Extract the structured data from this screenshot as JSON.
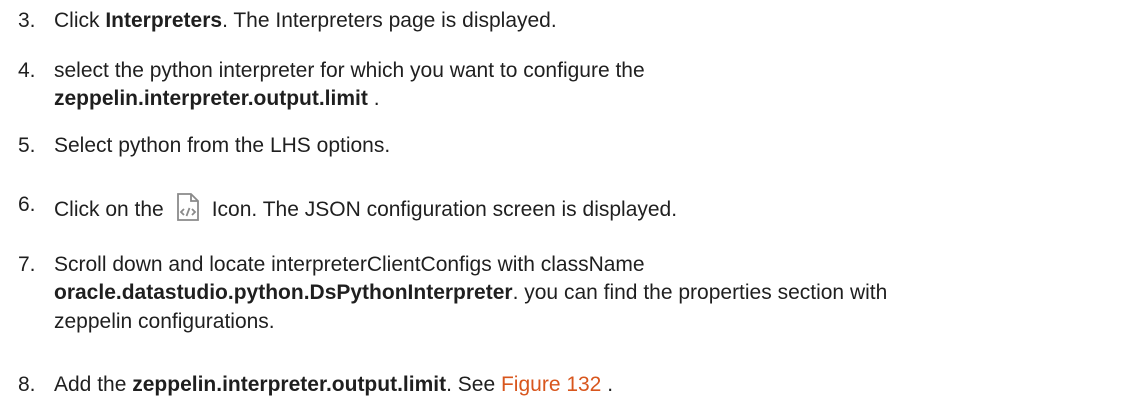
{
  "steps": [
    {
      "num": "3.",
      "pre": "Click ",
      "bold": "Interpreters",
      "post": ". The Interpreters page is displayed."
    },
    {
      "num": "4.",
      "line1": "select the python interpreter for which you want to configure the",
      "bold": "zeppelin.interpreter.output.limit",
      "post": " ."
    },
    {
      "num": "5.",
      "text": "Select python from the LHS options."
    },
    {
      "num": "6.",
      "pre": "Click on the",
      "icon": "json-config-file-icon",
      "post": "Icon. The JSON configuration screen is displayed."
    },
    {
      "num": "7.",
      "line1": "Scroll down and locate interpreterClientConfigs with className",
      "bold": "oracle.datastudio.python.DsPythonInterpreter",
      "post": ". you can find the properties section with",
      "line3": "zeppelin configurations."
    },
    {
      "num": "8.",
      "pre": "Add the ",
      "bold": "zeppelin.interpreter.output.limit",
      "mid": ". See ",
      "link": "Figure 132",
      "post": " ."
    }
  ],
  "colors": {
    "text": "#1f1f1f",
    "link": "#d8561d",
    "icon": "#8a8a8a"
  }
}
